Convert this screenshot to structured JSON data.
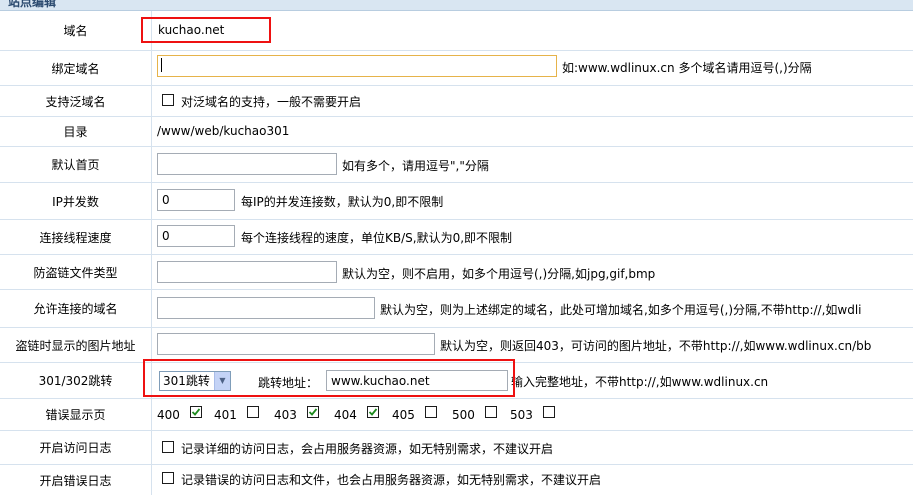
{
  "page": {
    "header_title": "站点编辑"
  },
  "rows": {
    "domain": {
      "label": "域名",
      "value": "kuchao.net"
    },
    "bind_domain": {
      "label": "绑定域名",
      "value": "",
      "hint": "如:www.wdlinux.cn 多个域名请用逗号(,)分隔"
    },
    "wildcard": {
      "label": "支持泛域名",
      "checked": false,
      "text": "对泛域名的支持，一般不需要开启"
    },
    "directory": {
      "label": "目录",
      "value": "/www/web/kuchao301"
    },
    "default_index": {
      "label": "默认首页",
      "value": "",
      "hint": "如有多个，请用逗号\",\"分隔"
    },
    "ip_concurrency": {
      "label": "IP并发数",
      "value": "0",
      "hint": "每IP的并发连接数，默认为0,即不限制"
    },
    "thread_speed": {
      "label": "连接线程速度",
      "value": "0",
      "hint": "每个连接线程的速度，单位KB/S,默认为0,即不限制"
    },
    "hotlink_types": {
      "label": "防盗链文件类型",
      "value": "",
      "hint": "默认为空，则不启用，如多个用逗号(,)分隔,如jpg,gif,bmp"
    },
    "allowed_domains": {
      "label": "允许连接的域名",
      "value": "",
      "hint": "默认为空，则为上述绑定的域名，此处可增加域名,如多个用逗号(,)分隔,不带http://,如wdli"
    },
    "hotlink_image": {
      "label": "盗链时显示的图片地址",
      "value": "",
      "hint": "默认为空，则返回403，可访问的图片地址，不带http://,如www.wdlinux.cn/bb"
    },
    "redirect": {
      "label": "301/302跳转",
      "select_value": "301跳转",
      "target_label": "跳转地址：",
      "target_value": "www.kuchao.net",
      "hint": "输入完整地址，不带http://,如www.wdlinux.cn"
    },
    "error_pages": {
      "label": "错误显示页",
      "codes": [
        {
          "code": "400",
          "checked": true
        },
        {
          "code": "401",
          "checked": false
        },
        {
          "code": "403",
          "checked": true
        },
        {
          "code": "404",
          "checked": true
        },
        {
          "code": "405",
          "checked": false
        },
        {
          "code": "500",
          "checked": false
        },
        {
          "code": "503",
          "checked": false
        }
      ]
    },
    "access_log": {
      "label": "开启访问日志",
      "checked": false,
      "text": "记录详细的访问日志，会占用服务器资源，如无特别需求，不建议开启"
    },
    "error_log": {
      "label": "开启错误日志",
      "checked": false,
      "text": "记录错误的访问日志和文件，也会占用服务器资源，如无特别需求，不建议开启"
    }
  },
  "colors": {
    "highlight": "#ee1111",
    "grid": "#d6e2ee",
    "focus_border": "#e6b34a"
  }
}
